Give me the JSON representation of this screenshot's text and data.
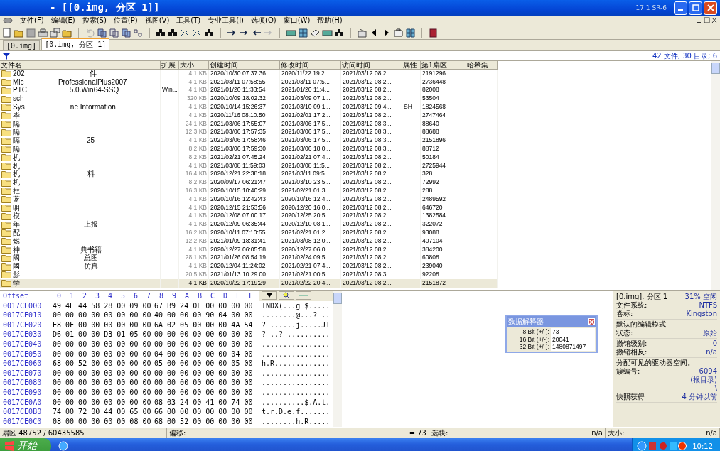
{
  "window": {
    "title": "- [[0.img, 分区 1]]",
    "version": "17.1 SR-6"
  },
  "menu": [
    "文件(F)",
    "编辑(E)",
    "搜索(S)",
    "位置(P)",
    "视图(V)",
    "工具(T)",
    "专业工具(I)",
    "选项(O)",
    "窗口(W)",
    "帮助(H)"
  ],
  "tabs": [
    {
      "label": "[0.img]",
      "selected": false
    },
    {
      "label": "[0.img, 分区 1]",
      "selected": true
    }
  ],
  "filter_bar": {
    "summary": "42 文件, 30 目录; 6"
  },
  "file_list": {
    "columns": [
      "文件名",
      "扩展",
      "大小",
      "创建时间",
      "修改时间",
      "访问时间",
      "属性",
      "第1扇区",
      "哈希集"
    ],
    "rows": [
      {
        "name_start": "202",
        "name_end": "件",
        "ext": "",
        "size": "4.1 KB",
        "created": "2020/10/30  07:37:36",
        "modified": "2020/11/22  19:2...",
        "accessed": "2021/03/12  08:2...",
        "attr": "",
        "first_sector": "2191296",
        "selected": false
      },
      {
        "name_start": "Mic",
        "name_end": "ProfessionalPlus2007",
        "ext": "",
        "size": "4.1 KB",
        "created": "2021/03/11  07:58:55",
        "modified": "2021/03/11  07:5...",
        "accessed": "2021/03/12  08:2...",
        "attr": "",
        "first_sector": "2736448",
        "selected": false
      },
      {
        "name_start": "PTC",
        "name_end": "5.0.Win64-SSQ",
        "ext": "Win...",
        "size": "4.1 KB",
        "created": "2021/01/20  11:33:54",
        "modified": "2021/01/20  11:4...",
        "accessed": "2021/03/12  08:2...",
        "attr": "",
        "first_sector": "82008",
        "selected": false
      },
      {
        "name_start": "sch",
        "name_end": "",
        "ext": "",
        "size": "320 KB",
        "created": "2020/10/09  18:02:32",
        "modified": "2021/03/09  07:1...",
        "accessed": "2021/03/12  08:2...",
        "attr": "",
        "first_sector": "53504",
        "selected": false
      },
      {
        "name_start": "Sys",
        "name_end": "ne Information",
        "ext": "",
        "size": "4.1 KB",
        "created": "2020/10/14  15:26:37",
        "modified": "2021/03/10  09:1...",
        "accessed": "2021/03/12  09:4...",
        "attr": "SH",
        "first_sector": "1824568",
        "selected": false
      },
      {
        "name_start": "毕",
        "name_end": "",
        "ext": "",
        "size": "4.1 KB",
        "created": "2020/11/16  08:10:50",
        "modified": "2021/02/01  17:2...",
        "accessed": "2021/03/12  08:2...",
        "attr": "",
        "first_sector": "2747464",
        "selected": false
      },
      {
        "name_start": "隔",
        "name_end": "",
        "ext": "",
        "size": "24.1 KB",
        "created": "2021/03/06  17:55:07",
        "modified": "2021/03/06  17:5...",
        "accessed": "2021/03/12  08:3...",
        "attr": "",
        "first_sector": "88640",
        "selected": false
      },
      {
        "name_start": "隔",
        "name_end": "",
        "ext": "",
        "size": "12.3 KB",
        "created": "2021/03/06  17:57:35",
        "modified": "2021/03/06  17:5...",
        "accessed": "2021/03/12  08:3...",
        "attr": "",
        "first_sector": "88688",
        "selected": false
      },
      {
        "name_start": "隔",
        "name_end": "25",
        "ext": "",
        "size": "4.1 KB",
        "created": "2021/03/06  17:58:46",
        "modified": "2021/03/06  17:5...",
        "accessed": "2021/03/12  08:3...",
        "attr": "",
        "first_sector": "2151896",
        "selected": false
      },
      {
        "name_start": "隔",
        "name_end": "",
        "ext": "",
        "size": "8.2 KB",
        "created": "2021/03/06  17:59:30",
        "modified": "2021/03/06  18:0...",
        "accessed": "2021/03/12  08:3...",
        "attr": "",
        "first_sector": "88712",
        "selected": false
      },
      {
        "name_start": "机",
        "name_end": "",
        "ext": "",
        "size": "8.2 KB",
        "created": "2021/02/21  07:45:24",
        "modified": "2021/02/21  07:4...",
        "accessed": "2021/03/12  08:2...",
        "attr": "",
        "first_sector": "50184",
        "selected": false
      },
      {
        "name_start": "机",
        "name_end": "",
        "ext": "",
        "size": "4.1 KB",
        "created": "2021/03/08  11:59:03",
        "modified": "2021/03/08  11:5...",
        "accessed": "2021/03/12  08:2...",
        "attr": "",
        "first_sector": "2725944",
        "selected": false
      },
      {
        "name_start": "机",
        "name_end": "料",
        "ext": "",
        "size": "16.4 KB",
        "created": "2020/12/21  22:38:18",
        "modified": "2021/03/11  09:5...",
        "accessed": "2021/03/12  08:2...",
        "attr": "",
        "first_sector": "328",
        "selected": false
      },
      {
        "name_start": "机",
        "name_end": "",
        "ext": "",
        "size": "8.2 KB",
        "created": "2020/09/17  06:21:47",
        "modified": "2021/03/10  23:5...",
        "accessed": "2021/03/12  08:2...",
        "attr": "",
        "first_sector": "72992",
        "selected": false
      },
      {
        "name_start": "框",
        "name_end": "",
        "ext": "",
        "size": "16.3 KB",
        "created": "2020/10/15  10:40:29",
        "modified": "2021/02/21  01:3...",
        "accessed": "2021/03/12  08:2...",
        "attr": "",
        "first_sector": "288",
        "selected": false
      },
      {
        "name_start": "蓝",
        "name_end": "",
        "ext": "",
        "size": "4.1 KB",
        "created": "2020/10/16  12:42:43",
        "modified": "2020/10/16  12:4...",
        "accessed": "2021/03/12  08:2...",
        "attr": "",
        "first_sector": "2489592",
        "selected": false
      },
      {
        "name_start": "明",
        "name_end": "",
        "ext": "",
        "size": "4.1 KB",
        "created": "2020/12/15  21:53:56",
        "modified": "2020/12/20  16:0...",
        "accessed": "2021/03/12  08:2...",
        "attr": "",
        "first_sector": "646720",
        "selected": false
      },
      {
        "name_start": "模",
        "name_end": "",
        "ext": "",
        "size": "4.1 KB",
        "created": "2020/12/08  07:00:17",
        "modified": "2020/12/25  20:5...",
        "accessed": "2021/03/12  08:2...",
        "attr": "",
        "first_sector": "1382584",
        "selected": false
      },
      {
        "name_start": "年",
        "name_end": "上报",
        "ext": "",
        "size": "4.1 KB",
        "created": "2020/12/09  06:35:44",
        "modified": "2020/12/10  08:1...",
        "accessed": "2021/03/12  08:2...",
        "attr": "",
        "first_sector": "322072",
        "selected": false
      },
      {
        "name_start": "配",
        "name_end": "",
        "ext": "",
        "size": "16.2 KB",
        "created": "2020/10/11  07:10:55",
        "modified": "2021/02/21  01:2...",
        "accessed": "2021/03/12  08:2...",
        "attr": "",
        "first_sector": "93088",
        "selected": false
      },
      {
        "name_start": "燃",
        "name_end": "",
        "ext": "",
        "size": "12.2 KB",
        "created": "2021/01/09  18:31:41",
        "modified": "2021/03/08  12:0...",
        "accessed": "2021/03/12  08:2...",
        "attr": "",
        "first_sector": "407104",
        "selected": false
      },
      {
        "name_start": "神",
        "name_end": "典书籍",
        "ext": "",
        "size": "4.1 KB",
        "created": "2020/12/27  06:05:58",
        "modified": "2020/12/27  06:0...",
        "accessed": "2021/03/12  08:2...",
        "attr": "",
        "first_sector": "384200",
        "selected": false
      },
      {
        "name_start": "阈",
        "name_end": "总图",
        "ext": "",
        "size": "28.1 KB",
        "created": "2021/01/26  08:54:19",
        "modified": "2021/02/24  09:5...",
        "accessed": "2021/03/12  08:2...",
        "attr": "",
        "first_sector": "60808",
        "selected": false
      },
      {
        "name_start": "阈",
        "name_end": "仿真",
        "ext": "",
        "size": "4.1 KB",
        "created": "2020/12/04  11:24:02",
        "modified": "2021/02/21  07:4...",
        "accessed": "2021/03/12  08:2...",
        "attr": "",
        "first_sector": "239040",
        "selected": false
      },
      {
        "name_start": "影",
        "name_end": "",
        "ext": "",
        "size": "20.5 KB",
        "created": "2021/01/13  10:29:00",
        "modified": "2021/02/21  00:5...",
        "accessed": "2021/03/12  08:3...",
        "attr": "",
        "first_sector": "92208",
        "selected": false
      },
      {
        "name_start": "学",
        "name_end": "",
        "ext": "",
        "size": "4.1 KB",
        "created": "2020/10/22  17:19:29",
        "modified": "2021/02/22  20:4...",
        "accessed": "2021/03/12  08:2...",
        "attr": "",
        "first_sector": "2151872",
        "selected": true
      }
    ]
  },
  "hex_view": {
    "offset_label": "Offset",
    "columns": [
      "0",
      "1",
      "2",
      "3",
      "4",
      "5",
      "6",
      "7",
      "8",
      "9",
      "A",
      "B",
      "C",
      "D",
      "E",
      "F"
    ],
    "rows": [
      {
        "offset": "0017CE000",
        "hex_left": "49 4E 44 58 28 00 09 00",
        "hex_right": "67 B9 24 0F 00 00 00 00",
        "text": "INDX(...g $....."
      },
      {
        "offset": "0017CE010",
        "hex_left": "00 00 00 00 00 00 00 00",
        "hex_right": "40 00 00 00 90 04 00 00",
        "text": "........@...? .."
      },
      {
        "offset": "0017CE020",
        "hex_left": "E8 0F 00 00 00 00 00 00",
        "hex_right": "6A 02 05 00 00 00 4A 54",
        "text": "? ......j.....JT"
      },
      {
        "offset": "0017CE030",
        "hex_left": "D6 01 00 00 D3 01 05 00",
        "hex_right": "00 00 00 00 00 00 00 00",
        "text": "? ..? .........."
      },
      {
        "offset": "0017CE040",
        "hex_left": "00 00 00 00 00 00 00 00",
        "hex_right": "00 00 00 00 00 00 00 00",
        "text": "................"
      },
      {
        "offset": "0017CE050",
        "hex_left": "00 00 00 00 00 00 00 00",
        "hex_right": "04 00 00 00 00 00 04 00",
        "text": "................"
      },
      {
        "offset": "0017CE060",
        "hex_left": "68 00 52 00 00 00 00 00",
        "hex_right": "05 00 00 00 00 00 05 00",
        "text": "h.R............."
      },
      {
        "offset": "0017CE070",
        "hex_left": "00 00 00 00 00 00 00 00",
        "hex_right": "00 00 00 00 00 00 00 00",
        "text": "................"
      },
      {
        "offset": "0017CE080",
        "hex_left": "00 00 00 00 00 00 00 00",
        "hex_right": "00 00 00 00 00 00 00 00",
        "text": "................"
      },
      {
        "offset": "0017CE090",
        "hex_left": "00 00 00 00 00 00 00 00",
        "hex_right": "00 00 00 00 00 00 00 00",
        "text": "................"
      },
      {
        "offset": "0017CE0A0",
        "hex_left": "00 00 00 00 00 00 00 00",
        "hex_right": "08 03 24 00 41 00 74 00",
        "text": "..........$.A.t."
      },
      {
        "offset": "0017CE0B0",
        "hex_left": "74 00 72 00 44 00 65 00",
        "hex_right": "66 00 00 00 00 00 00 00",
        "text": "t.r.D.e.f......."
      },
      {
        "offset": "0017CE0C0",
        "hex_left": "08 00 00 00 00 00 08 00",
        "hex_right": "68 00 52 00 00 00 00 00",
        "text": "........h.R....."
      }
    ]
  },
  "data_interpreter": {
    "title": "数据解释器",
    "rows": [
      {
        "label": "8 Bit (+/-):",
        "value": "73"
      },
      {
        "label": "16 Bit (+/-):",
        "value": "20041"
      },
      {
        "label": "32 Bit (+/-):",
        "value": "1480871497"
      }
    ]
  },
  "info_panel": [
    [
      {
        "label": "[0.img], 分区 1",
        "value": "31% 空闲"
      },
      {
        "label": "文件系统:",
        "value": "NTFS"
      },
      {
        "label": "卷标:",
        "value": "Kingston"
      }
    ],
    [
      {
        "label": "默认的编辑模式"
      },
      {
        "label": "状态:",
        "value": "原始"
      }
    ],
    [
      {
        "label": "撤销级别:",
        "value": "0"
      },
      {
        "label": "撤销相反:",
        "value": "n/a"
      }
    ],
    [
      {
        "label": "分配可见的驱动器空间。"
      },
      {
        "label": "簇编号:",
        "value": "6094"
      },
      {
        "value": "(根目录)"
      },
      {
        "value": "\\"
      },
      {
        "label": "快照获得",
        "value": "4 分钟以前"
      }
    ]
  ],
  "status_bar": {
    "sector": "扇区 48752 / 60435585",
    "offset_label": "偏移:",
    "offset_value": "= 73",
    "block_label": "选块:",
    "block_value": "n/a",
    "size_label": "大小:",
    "size_value": "n/a"
  },
  "taskbar": {
    "start": "开始",
    "clock": "10:12"
  }
}
